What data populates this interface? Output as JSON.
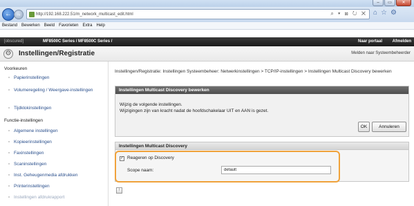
{
  "browser": {
    "url": "http://192.168.222.51/m_network_multicast_edit.html",
    "address_tools": "⌕ ▾ ⊠ ↻ ✕",
    "menu": [
      "Bestand",
      "Bewerken",
      "Beeld",
      "Favorieten",
      "Extra",
      "Help"
    ]
  },
  "device": {
    "model": "[obscured]",
    "title": "MF8500C Series / MF8500C Series /",
    "portal_link": "Naar portaal",
    "logout_link": "Afmelden"
  },
  "page": {
    "title": "Instellingen/Registratie",
    "sysadmin_link": "Melden naar Systeembeheerder"
  },
  "sidebar": {
    "preferences_heading": "Voorkeuren",
    "preferences": [
      "Papierinstellingen",
      "Volumeregeling / Weergave-instellingen",
      "Tijdklokinstellingen"
    ],
    "functions_heading": "Functie-instellingen",
    "functions": [
      "Algemene instellingen",
      "Kopieerinstellingen",
      "Faxinstellingen",
      "Scaninstellingen",
      "Inst. Geheugenmedia afdrukken",
      "Printerinstellingen",
      "Instellingen afdrukrapport"
    ]
  },
  "breadcrumb": "Instellingen/Registratie: Instellingen Systeembeheer: Netwerkinstellingen > TCP/IP-instellingen > Instellingen Multicast Discovery bewerken",
  "edit_panel": {
    "heading": "Instellingen Multicast Discovery bewerken",
    "line1": "Wijzig de volgende instellingen.",
    "line2": "Wijzigingen zijn van kracht nadat de hoofdschakelaar UIT en AAN is gezet.",
    "ok_label": "OK",
    "cancel_label": "Annuleren"
  },
  "discovery_panel": {
    "heading": "Instellingen Multicast Discovery",
    "respond_label": "Reageren op Discovery",
    "respond_checked": true,
    "scope_label": "Scope naam:",
    "scope_value": "default"
  },
  "colors": {
    "highlight": "#f0a23a",
    "device_bar": "#1c1c1c",
    "panel_head": "#4e4e4e",
    "link": "#2a4f8c"
  }
}
